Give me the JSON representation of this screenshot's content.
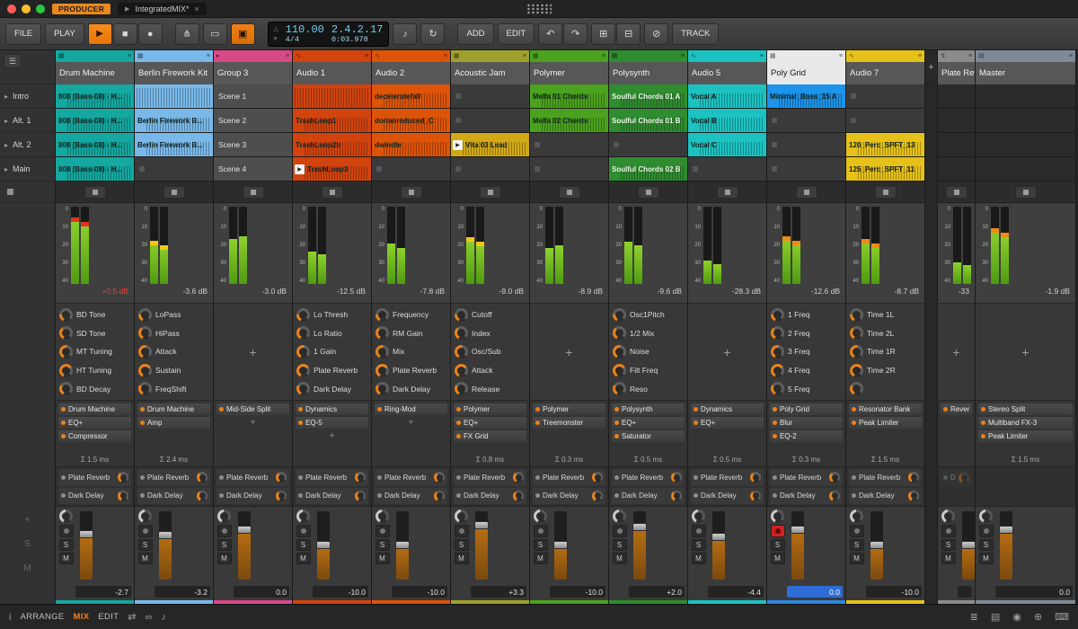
{
  "window": {
    "producer_badge": "PRODUCER",
    "doc_tab": "IntegratedMIX*",
    "close": "×"
  },
  "toolbar": {
    "file": "FILE",
    "play_label": "PLAY",
    "add": "ADD",
    "edit": "EDIT",
    "track": "TRACK",
    "tempo": "110.00",
    "time_sig": "4/4",
    "position": "2.4.2.17",
    "clock": "0:03.978"
  },
  "icons": {
    "play": "▶",
    "stop": "■",
    "record": "●",
    "branch": "⋔",
    "display": "▭",
    "touch": "▣",
    "metronome": "△",
    "mixer": "≡",
    "loop": "↻",
    "undo": "↶",
    "redo": "↷",
    "copy": "⊞",
    "paste": "⊟",
    "cancel": "⊘",
    "menu": "☰",
    "scene_play": "▸",
    "plus": "+",
    "info": "i",
    "shuffle": "⇄",
    "infinity": "∞",
    "note": "♪",
    "layers": "≣",
    "panel": "▤",
    "browser": "◉",
    "target": "⊕",
    "keys": "⌨",
    "snap": "⌖",
    "solo": "S",
    "mute": "M",
    "tab_tri": "▶"
  },
  "labels": {
    "mute": "M",
    "solo": "S"
  },
  "colors": {
    "accent": "#f08018",
    "display_text": "#6ccdf0",
    "meter_green": "#8ed22b",
    "meter_yellow": "#f2c818",
    "meter_orange": "#f08a18",
    "meter_red": "#e33222"
  },
  "scenes": [
    "Intro",
    "Alt. 1",
    "Alt. 2",
    "Main"
  ],
  "bottom_bar": {
    "arrange": "ARRANGE",
    "mix": "MIX",
    "edit": "EDIT"
  },
  "tracks": [
    {
      "name": "Drum Machine",
      "width": 88,
      "color": "#14a8a0",
      "icon": "▦",
      "clips": [
        {
          "t": "clip",
          "label": "808 (Bass-08) - H..."
        },
        {
          "t": "clip",
          "label": "808 (Bass-08) - H..."
        },
        {
          "t": "clip",
          "label": "808 (Bass-08) - H..."
        },
        {
          "t": "clip",
          "label": "808 (Bass-08) - H..."
        }
      ],
      "meter": {
        "l": 0.86,
        "r": 0.8,
        "cap": "red",
        "db": "+0.5 dB",
        "alert": true
      },
      "knobs": [
        "BD Tone",
        "SD Tone",
        "MT Tuning",
        "HT Tuning",
        "BD Decay"
      ],
      "devices": [
        "Drum Machine",
        "EQ+",
        "Compressor"
      ],
      "devPlus": false,
      "sigma": "Σ 1.5 ms",
      "sends": [
        "Plate Reverb",
        "Dark Delay"
      ],
      "fader": {
        "value": "-2.7"
      }
    },
    {
      "name": "Berlin Firework Kit",
      "width": 88,
      "color": "#79b8e8",
      "icon": "▦",
      "clips": [
        {
          "t": "wave"
        },
        {
          "t": "clip",
          "label": "Berlin Firework B..."
        },
        {
          "t": "clip",
          "label": "Berlin Firework B..."
        },
        {
          "t": "empty"
        }
      ],
      "meter": {
        "l": 0.56,
        "r": 0.5,
        "cap": "yellow",
        "db": "-3.6 dB"
      },
      "knobs": [
        "LoPass",
        "HiPass",
        "Attack",
        "Sustain",
        "FreqShift"
      ],
      "devices": [
        "Drum Machine",
        "Amp"
      ],
      "devPlus": false,
      "sigma": "Σ 2.4 ms",
      "sends": [
        "Plate Reverb",
        "Dark Delay"
      ],
      "fader": {
        "value": "-3.2"
      }
    },
    {
      "name": "Group 3",
      "width": 88,
      "color": "#d84a86",
      "icon": "▸",
      "clips": [
        {
          "t": "scene",
          "label": "Scene 1"
        },
        {
          "t": "scene",
          "label": "Scene 2"
        },
        {
          "t": "scene",
          "label": "Scene 3"
        },
        {
          "t": "scene",
          "label": "Scene 4"
        }
      ],
      "meter": {
        "l": 0.58,
        "r": 0.62,
        "db": "-3.0 dB"
      },
      "knobs": [],
      "devices": [
        "Mid-Side Split"
      ],
      "devPlus": true,
      "sigma": "",
      "sends": [
        "Plate Reverb",
        "Dark Delay"
      ],
      "fader": {
        "value": "0.0"
      }
    },
    {
      "name": "Audio 1",
      "width": 88,
      "color": "#d2430e",
      "icon": "∿",
      "clips": [
        {
          "t": "wave"
        },
        {
          "t": "clip",
          "label": "TrashLoop1"
        },
        {
          "t": "clip",
          "label": "TrashLoop2b"
        },
        {
          "t": "clip",
          "label": "TrashLoop3",
          "play": true
        }
      ],
      "meter": {
        "l": 0.42,
        "r": 0.38,
        "db": "-12.5 dB"
      },
      "knobs": [
        "Lo Thresh",
        "Lo Ratio",
        "1 Gain",
        "Plate Reverb",
        "Dark Delay"
      ],
      "devices": [
        "Dynamics",
        "EQ-5"
      ],
      "devPlus": true,
      "sigma": "",
      "sends": [
        "Plate Reverb",
        "Dark Delay"
      ],
      "fader": {
        "value": "-10.0"
      }
    },
    {
      "name": "Audio 2",
      "width": 88,
      "color": "#dd5409",
      "icon": "∿",
      "clips": [
        {
          "t": "clip",
          "label": "deceleratefall"
        },
        {
          "t": "clip",
          "label": "dorianreduced_C"
        },
        {
          "t": "clip",
          "label": "dwindle"
        },
        {
          "t": "empty"
        }
      ],
      "meter": {
        "l": 0.52,
        "r": 0.47,
        "db": "-7.8 dB"
      },
      "knobs": [
        "Frequency",
        "RM Gain",
        "Mix",
        "Plate Reverb",
        "Dark Delay"
      ],
      "devices": [
        "Ring-Mod"
      ],
      "devPlus": true,
      "sigma": "",
      "sends": [
        "Plate Reverb",
        "Dark Delay"
      ],
      "fader": {
        "value": "-10.0"
      }
    },
    {
      "name": "Acoustic Jam",
      "width": 88,
      "color": "#9fa02c",
      "icon": "▦",
      "clips": [
        {
          "t": "empty"
        },
        {
          "t": "empty"
        },
        {
          "t": "clip",
          "label": "Vita 03 Lead",
          "play": true,
          "color": "#d2a816"
        },
        {
          "t": "empty"
        }
      ],
      "meter": {
        "l": 0.6,
        "r": 0.55,
        "cap": "yellow",
        "db": "-9.0 dB"
      },
      "knobs": [
        "Cutoff",
        "Index",
        "Osc/Sub",
        "Attack",
        "Release"
      ],
      "devices": [
        "Polymer",
        "EQ+",
        "FX Grid"
      ],
      "devPlus": false,
      "sigma": "Σ 0.8 ms",
      "sends": [
        "Plate Reverb",
        "Dark Delay"
      ],
      "fader": {
        "value": "+3.3"
      }
    },
    {
      "name": "Polymer",
      "width": 88,
      "color": "#4aa21e",
      "icon": "▦",
      "clips": [
        {
          "t": "clip",
          "label": "Mella 01 Chords"
        },
        {
          "t": "clip",
          "label": "Mella 02 Chords"
        },
        {
          "t": "empty"
        },
        {
          "t": "empty"
        }
      ],
      "meter": {
        "l": 0.46,
        "r": 0.5,
        "db": "-8.9 dB"
      },
      "knobs": [],
      "devices": [
        "Polymer",
        "Treemonster"
      ],
      "devPlus": false,
      "sigma": "Σ 0.3 ms",
      "sends": [
        "Plate Reverb",
        "Dark Delay"
      ],
      "fader": {
        "value": "-10.0"
      }
    },
    {
      "name": "Polysynth",
      "width": 88,
      "color": "#2f8c2f",
      "icon": "▦",
      "clipText": "light",
      "clips": [
        {
          "t": "clip",
          "label": "Soulful Chords 01 A"
        },
        {
          "t": "clip",
          "label": "Soulful Chords 01 B"
        },
        {
          "t": "empty"
        },
        {
          "t": "clip",
          "label": "Soulful Chords 02 B"
        }
      ],
      "meter": {
        "l": 0.55,
        "r": 0.5,
        "db": "-9.6 dB"
      },
      "knobs": [
        "Osc1Pitch",
        "1/2 Mix",
        "Noise",
        "Filt Freq",
        "Reso"
      ],
      "devices": [
        "Polysynth",
        "EQ+",
        "Saturator"
      ],
      "devPlus": false,
      "sigma": "Σ 0.5 ms",
      "sends": [
        "Plate Reverb",
        "Dark Delay"
      ],
      "fader": {
        "value": "+2.0"
      }
    },
    {
      "name": "Audio 5",
      "width": 88,
      "color": "#1cc2c2",
      "icon": "∿",
      "clips": [
        {
          "t": "clip",
          "label": "Vocal A"
        },
        {
          "t": "clip",
          "label": "Vocal B"
        },
        {
          "t": "clip",
          "label": "Vocal C"
        },
        {
          "t": "empty"
        }
      ],
      "meter": {
        "l": 0.3,
        "r": 0.26,
        "db": "-28.3 dB"
      },
      "knobs": [],
      "devices": [
        "Dynamics",
        "EQ+"
      ],
      "devPlus": false,
      "sigma": "Σ 0.5 ms",
      "sends": [
        "Plate Reverb",
        "Dark Delay"
      ],
      "fader": {
        "value": "-4.4"
      }
    },
    {
      "name": "Poly Grid",
      "width": 88,
      "color": "#2f87e0",
      "icon": "▦",
      "selected": true,
      "clips": [
        {
          "t": "clip",
          "label": "Minimal_Bass_15 A",
          "color": "#1d93ea"
        },
        {
          "t": "empty"
        },
        {
          "t": "empty"
        },
        {
          "t": "empty"
        }
      ],
      "meter": {
        "l": 0.62,
        "r": 0.56,
        "cap": "orange",
        "db": "-12.6 dB"
      },
      "knobs": [
        "1 Freq",
        "2 Freq",
        "3 Freq",
        "4 Freq",
        "5 Freq"
      ],
      "devices": [
        "Poly Grid",
        "Blur",
        "EQ-2"
      ],
      "devPlus": false,
      "sigma": "Σ 0.3 ms",
      "sends": [
        "Plate Reverb",
        "Dark Delay"
      ],
      "fader": {
        "value": "0.0",
        "highlight": true,
        "armed": true
      }
    },
    {
      "name": "Audio 7",
      "width": 88,
      "color": "#e6c11a",
      "icon": "∿",
      "clips": [
        {
          "t": "empty"
        },
        {
          "t": "empty"
        },
        {
          "t": "clip",
          "label": "120_Perc_SPFT_13"
        },
        {
          "t": "clip",
          "label": "125_Perc_SPFT_11"
        }
      ],
      "meter": {
        "l": 0.58,
        "r": 0.52,
        "cap": "orange",
        "db": "-8.7 dB"
      },
      "knobs": [
        "Time 1L",
        "Time 2L",
        "Time 1R",
        "Time 2R",
        ""
      ],
      "devices": [
        "Resonator Bank",
        "Peak Limiter"
      ],
      "devPlus": false,
      "sigma": "Σ 1.5 ms",
      "sends": [
        "Plate Reverb",
        "Dark Delay"
      ],
      "fader": {
        "value": "-10.0"
      }
    },
    {
      "divider": true,
      "width": 14
    },
    {
      "name": "Plate Reverb",
      "width": 42,
      "color": "#8b8b8b",
      "icon": "↯",
      "dimSends": true,
      "clips": [
        {
          "t": "blank"
        },
        {
          "t": "blank"
        },
        {
          "t": "blank"
        },
        {
          "t": "blank"
        }
      ],
      "meter": {
        "l": 0.28,
        "r": 0.24,
        "db": "-33"
      },
      "knobs": [],
      "devices": [
        "Reverb"
      ],
      "devPlus": false,
      "sigma": "",
      "sends": [
        "Dark Delay"
      ],
      "fader": {
        "value": ""
      }
    },
    {
      "name": "Master",
      "width": 112,
      "color": "#7d8b99",
      "icon": "▤",
      "clips": [
        {
          "t": "blank"
        },
        {
          "t": "blank"
        },
        {
          "t": "blank"
        },
        {
          "t": "blank"
        }
      ],
      "meter": {
        "l": 0.72,
        "r": 0.66,
        "cap": "orange",
        "db": "-1.9 dB"
      },
      "knobs": [],
      "devices": [
        "Stereo Split",
        "Multiband FX-3",
        "Peak Limiter"
      ],
      "devPlus": false,
      "sigma": "Σ 1.5 ms",
      "sends": [],
      "fader": {
        "value": "0.0"
      }
    }
  ]
}
